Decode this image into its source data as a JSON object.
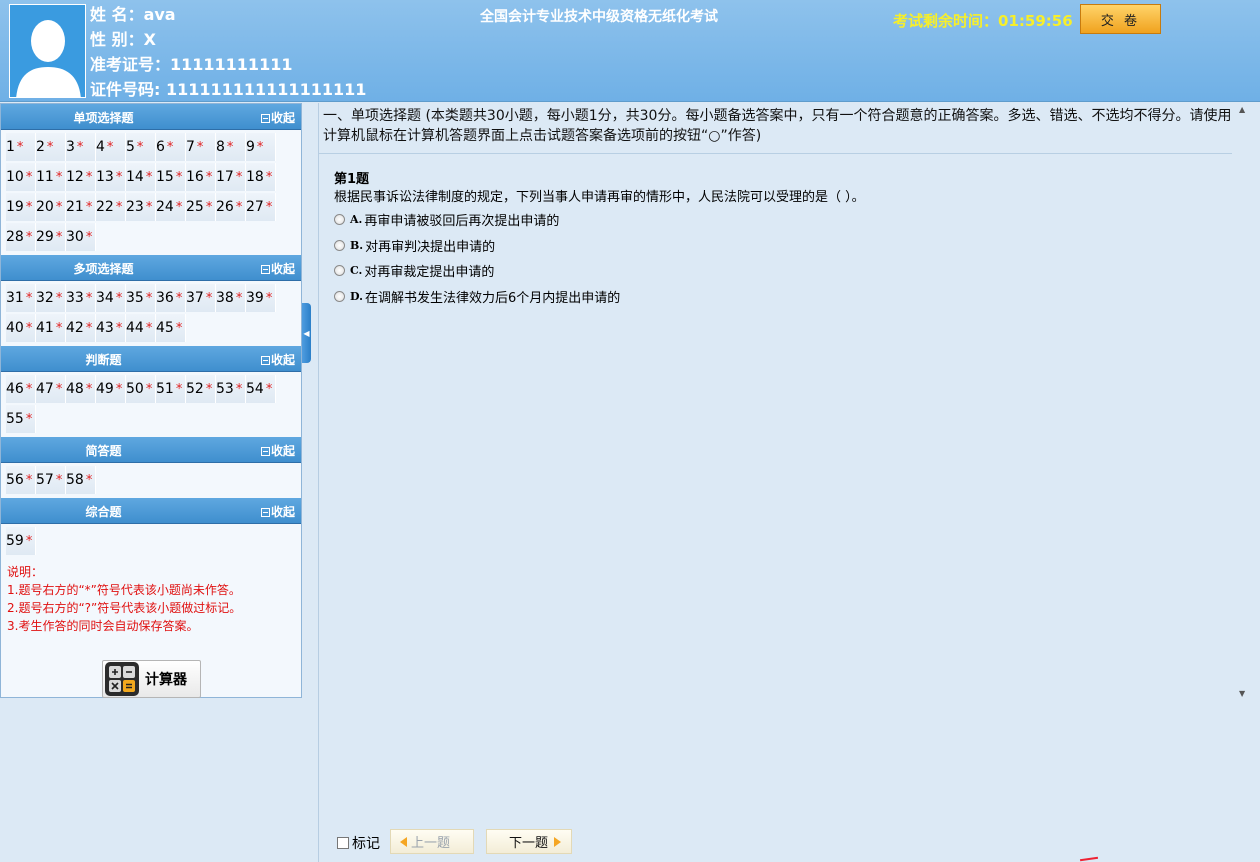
{
  "candidate": {
    "name": "姓 名：ava",
    "gender": "性 别：X",
    "exam_no": "准考证号：11111111111",
    "id_no": "证件号码: 111111111111111111"
  },
  "header": {
    "title": "全国会计专业技术中级资格无纸化考试",
    "timer_label": "考试剩余时间：",
    "timer_value": "01:59:56",
    "submit_label": "交 卷"
  },
  "sections": [
    {
      "title": "单项选择题",
      "collapse_label": "收起",
      "questions": [
        "1",
        "2",
        "3",
        "4",
        "5",
        "6",
        "7",
        "8",
        "9",
        "10",
        "11",
        "12",
        "13",
        "14",
        "15",
        "16",
        "17",
        "18",
        "19",
        "20",
        "21",
        "22",
        "23",
        "24",
        "25",
        "26",
        "27",
        "28",
        "29",
        "30"
      ]
    },
    {
      "title": "多项选择题",
      "collapse_label": "收起",
      "questions": [
        "31",
        "32",
        "33",
        "34",
        "35",
        "36",
        "37",
        "38",
        "39",
        "40",
        "41",
        "42",
        "43",
        "44",
        "45"
      ]
    },
    {
      "title": "判断题",
      "collapse_label": "收起",
      "questions": [
        "46",
        "47",
        "48",
        "49",
        "50",
        "51",
        "52",
        "53",
        "54",
        "55"
      ]
    },
    {
      "title": "简答题",
      "collapse_label": "收起",
      "questions": [
        "56",
        "57",
        "58"
      ]
    },
    {
      "title": "综合题",
      "collapse_label": "收起",
      "questions": [
        "59"
      ]
    }
  ],
  "unanswered_mark": "*",
  "notes": [
    "说明：",
    "1.题号右方的“*”符号代表该小题尚未作答。",
    "2.题号右方的“?”符号代表该小题做过标记。",
    "3.考生作答的同时会自动保存答案。"
  ],
  "calculator_label": "计算器",
  "instructions": "一、单项选择题 (本类题共30小题，每小题1分，共30分。每小题备选答案中，只有一个符合题意的正确答案。多选、错选、不选均不得分。请使用计算机鼠标在计算机答题界面上点击试题答案备选项前的按钮“○”作答)",
  "question": {
    "number": "第1题",
    "text": "根据民事诉讼法律制度的规定，下列当事人申请再审的情形中，人民法院可以受理的是（    ）。",
    "options": [
      {
        "letter": "A.",
        "text": "再审申请被驳回后再次提出申请的"
      },
      {
        "letter": "B.",
        "text": "对再审判决提出申请的"
      },
      {
        "letter": "C.",
        "text": "对再审裁定提出申请的"
      },
      {
        "letter": "D.",
        "text": "在调解书发生法律效力后6个月内提出申请的"
      }
    ]
  },
  "footer": {
    "mark_label": "标记",
    "prev_label": "上一题",
    "next_label": "下一题"
  },
  "colors": {
    "header_bg": "#7ab8ea",
    "timer": "#f7ef2a",
    "section_header": "#4a97d6",
    "unanswered_star": "#e02020",
    "note_text": "#e01010",
    "submit_btn": "#f5b43a"
  }
}
